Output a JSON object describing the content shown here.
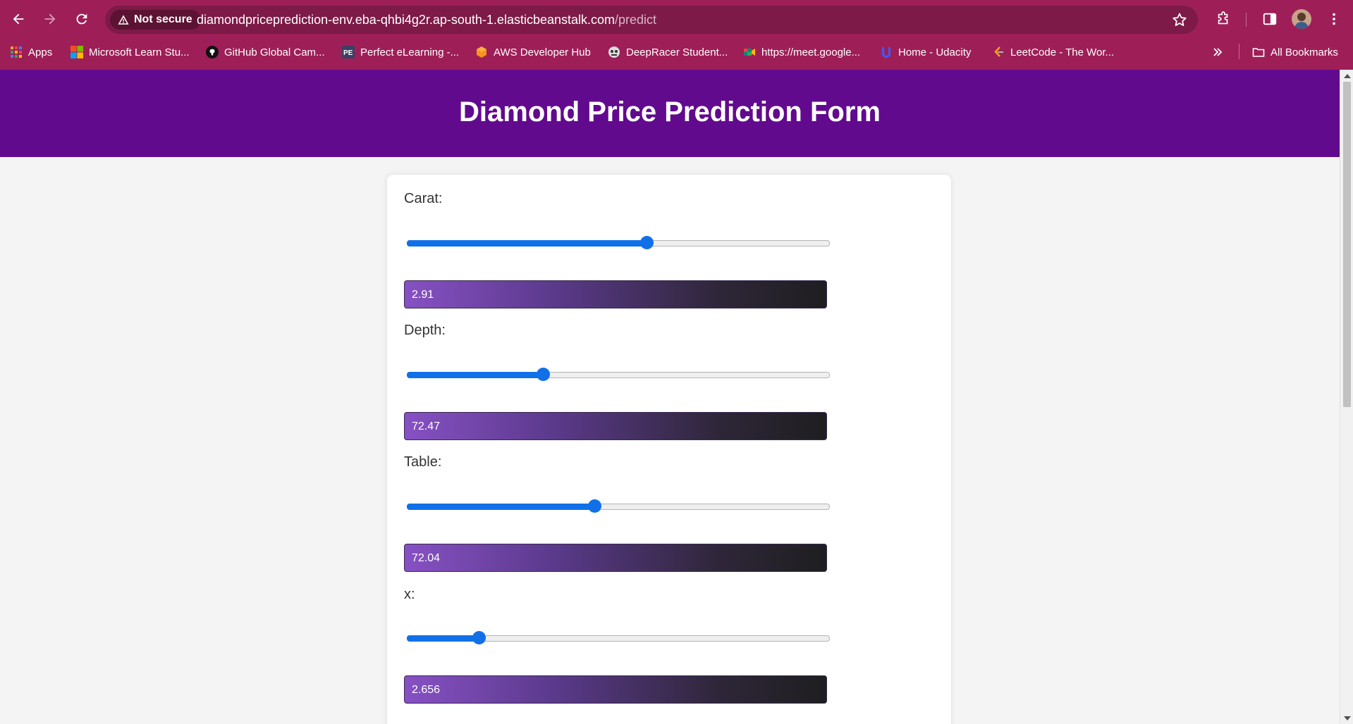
{
  "browser": {
    "security_label": "Not secure",
    "url_host": "diamondpriceprediction-env.eba-qhbi4g2r.ap-south-1.elasticbeanstalk.com",
    "url_path": "/predict",
    "icons": [
      "back-icon",
      "forward-icon",
      "reload-icon",
      "warning-icon",
      "star-icon",
      "extensions-icon",
      "side-panel-icon",
      "menu-icon"
    ]
  },
  "bookmarks": {
    "items": [
      {
        "label": "Apps",
        "icon": "apps-grid-icon"
      },
      {
        "label": "Microsoft Learn Stu...",
        "icon": "microsoft-icon"
      },
      {
        "label": "GitHub Global Cam...",
        "icon": "github-icon"
      },
      {
        "label": "Perfect eLearning -...",
        "icon": "pe-icon"
      },
      {
        "label": "AWS Developer Hub",
        "icon": "aws-icon"
      },
      {
        "label": "DeepRacer Student...",
        "icon": "deepracer-icon"
      },
      {
        "label": "https://meet.google...",
        "icon": "meet-icon"
      },
      {
        "label": "Home - Udacity",
        "icon": "udacity-icon"
      },
      {
        "label": "LeetCode - The Wor...",
        "icon": "leetcode-icon"
      }
    ],
    "all_bookmarks_label": "All Bookmarks"
  },
  "page": {
    "title": "Diamond Price Prediction Form",
    "header_color": "#620a8e",
    "accent_color": "#1170e8",
    "fields": [
      {
        "label": "Carat:",
        "value": "2.91",
        "slider_fraction": 0.569
      },
      {
        "label": "Depth:",
        "value": "72.47",
        "slider_fraction": 0.322
      },
      {
        "label": "Table:",
        "value": "72.04",
        "slider_fraction": 0.444
      },
      {
        "label": "x:",
        "value": "2.656",
        "slider_fraction": 0.17
      }
    ]
  }
}
